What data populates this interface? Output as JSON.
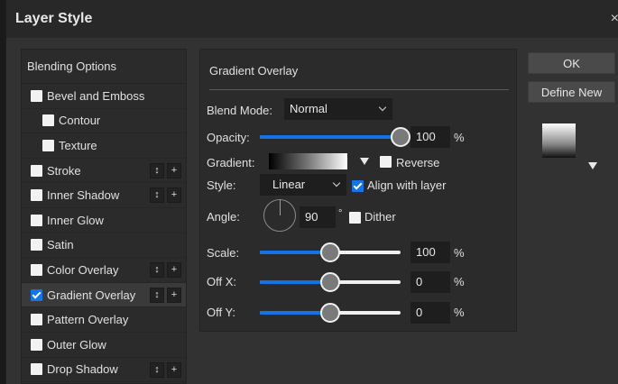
{
  "window": {
    "title": "Layer Style",
    "close_glyph": "×"
  },
  "blending_options": {
    "label": "Blending Options"
  },
  "layers": [
    {
      "label": "Bevel and Emboss",
      "checked": false,
      "sub": false,
      "buttons": false
    },
    {
      "label": "Contour",
      "checked": false,
      "sub": true,
      "buttons": false
    },
    {
      "label": "Texture",
      "checked": false,
      "sub": true,
      "buttons": false
    },
    {
      "label": "Stroke",
      "checked": false,
      "sub": false,
      "buttons": true
    },
    {
      "label": "Inner Shadow",
      "checked": false,
      "sub": false,
      "buttons": true
    },
    {
      "label": "Inner Glow",
      "checked": false,
      "sub": false,
      "buttons": false
    },
    {
      "label": "Satin",
      "checked": false,
      "sub": false,
      "buttons": false
    },
    {
      "label": "Color Overlay",
      "checked": false,
      "sub": false,
      "buttons": true
    },
    {
      "label": "Gradient Overlay",
      "checked": true,
      "sub": false,
      "buttons": true,
      "active": true
    },
    {
      "label": "Pattern Overlay",
      "checked": false,
      "sub": false,
      "buttons": false
    },
    {
      "label": "Outer Glow",
      "checked": false,
      "sub": false,
      "buttons": false
    },
    {
      "label": "Drop Shadow",
      "checked": false,
      "sub": false,
      "buttons": true
    }
  ],
  "mini_buttons": {
    "move": "↕",
    "add": "+"
  },
  "panel": {
    "title": "Gradient Overlay",
    "blend_mode": {
      "label": "Blend Mode:",
      "value": "Normal"
    },
    "opacity": {
      "label": "Opacity:",
      "value": "100",
      "unit": "%",
      "level": 1.0
    },
    "gradient": {
      "label": "Gradient:",
      "reverse_label": "Reverse",
      "reverse_checked": false
    },
    "style": {
      "label": "Style:",
      "value": "Linear",
      "align_label": "Align with layer",
      "align_checked": true
    },
    "angle": {
      "label": "Angle:",
      "value": "90",
      "unit": "°",
      "dither_label": "Dither",
      "dither_checked": false
    },
    "scale": {
      "label": "Scale:",
      "value": "100",
      "unit": "%",
      "level": 0.5
    },
    "offx": {
      "label": "Off X:",
      "value": "0",
      "unit": "%",
      "level": 0.5
    },
    "offy": {
      "label": "Off Y:",
      "value": "0",
      "unit": "%",
      "level": 0.5
    }
  },
  "buttons": {
    "ok": "OK",
    "define_new": "Define New"
  },
  "colors": {
    "accent": "#1473e6",
    "panel": "#2b2b2b",
    "dialog": "#323232"
  }
}
